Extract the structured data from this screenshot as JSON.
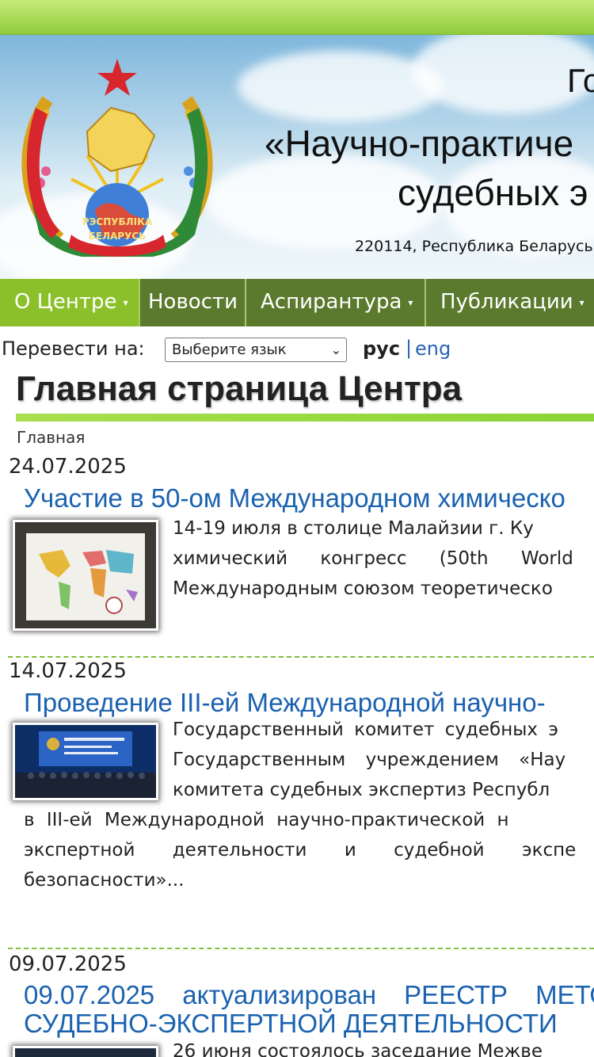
{
  "header": {
    "line1": "Го",
    "line2": "«Научно-практиче",
    "line3": "судебных э",
    "address": "220114, Республика Беларусь",
    "emblem_ribbon_top": "РЭСПУБЛІКА",
    "emblem_ribbon_bottom": "БЕЛАРУСЬ"
  },
  "nav": {
    "items": [
      {
        "label": "О Центре",
        "has_dropdown": true
      },
      {
        "label": "Новости",
        "has_dropdown": false
      },
      {
        "label": "Аспирантура",
        "has_dropdown": true
      },
      {
        "label": "Публикации",
        "has_dropdown": true
      }
    ],
    "caret": "▾"
  },
  "translate": {
    "label": "Перевести на:",
    "select_value": "Выберите язык",
    "select_arrow": "⌄",
    "lang_ru": "рус",
    "separator": "|",
    "lang_en": "eng"
  },
  "page": {
    "title": "Главная страница Центра",
    "breadcrumb": "Главная"
  },
  "news": [
    {
      "date": "24.07.2025",
      "title": "Участие в 50-ом Международном химическо",
      "text_lines": [
        "14-19 июля в столице Малайзии г. Ку",
        "химический конгресс (50th World",
        "Международным союзом теоретическо"
      ],
      "thumb_icon": "world-map-photo"
    },
    {
      "date": "14.07.2025",
      "title": "Проведение III-ей Международной научно-",
      "text_lines": [
        "Государственный комитет судебных э",
        "Государственным учреждением «Нау",
        "комитета судебных экспертиз Республ",
        "в III-ей Международной научно-практической н",
        "экспертной деятельности и судебной экспе",
        "безопасности»..."
      ],
      "thumb_icon": "conference-photo"
    },
    {
      "date": "09.07.2025",
      "title": "09.07.2025 актуализирован РЕЕСТР МЕТО СУДЕБНО-ЭКСПЕРТНОЙ ДЕЯТЕЛЬНОСТИ",
      "text_lines": [
        "26 июня состоялось заседание Межве"
      ],
      "thumb_icon": "document-photo"
    }
  ],
  "colors": {
    "nav_bg": "#5c7a2d",
    "nav_active": "#8bc02b",
    "link": "#1a62b0",
    "accent_green": "#8bd435"
  }
}
